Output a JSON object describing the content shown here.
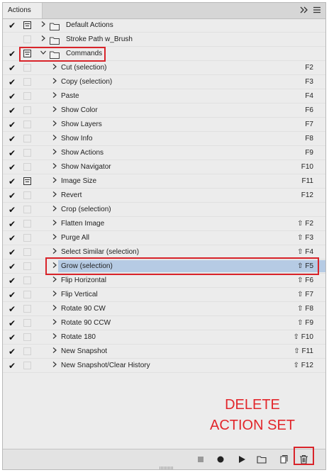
{
  "panel": {
    "tab_label": "Actions",
    "collapse_glyph": "›››",
    "menu_glyph": "≡"
  },
  "rows": [
    {
      "level": 0,
      "checked": true,
      "dialog": true,
      "expanded": false,
      "folder": true,
      "label": "Default Actions",
      "shortcut": ""
    },
    {
      "level": 0,
      "checked": false,
      "dialog": false,
      "expanded": false,
      "folder": true,
      "label": "Stroke Path w_Brush",
      "shortcut": ""
    },
    {
      "level": 0,
      "checked": true,
      "dialog": true,
      "expanded": true,
      "folder": true,
      "label": "Commands",
      "shortcut": ""
    },
    {
      "level": 1,
      "checked": true,
      "dialog": false,
      "label": "Cut (selection)",
      "shortcut": "F2"
    },
    {
      "level": 1,
      "checked": true,
      "dialog": false,
      "label": "Copy (selection)",
      "shortcut": "F3"
    },
    {
      "level": 1,
      "checked": true,
      "dialog": false,
      "label": "Paste",
      "shortcut": "F4"
    },
    {
      "level": 1,
      "checked": true,
      "dialog": false,
      "label": "Show Color",
      "shortcut": "F6"
    },
    {
      "level": 1,
      "checked": true,
      "dialog": false,
      "label": "Show Layers",
      "shortcut": "F7"
    },
    {
      "level": 1,
      "checked": true,
      "dialog": false,
      "label": "Show Info",
      "shortcut": "F8"
    },
    {
      "level": 1,
      "checked": true,
      "dialog": false,
      "label": "Show Actions",
      "shortcut": "F9"
    },
    {
      "level": 1,
      "checked": true,
      "dialog": false,
      "label": "Show Navigator",
      "shortcut": "F10"
    },
    {
      "level": 1,
      "checked": true,
      "dialog": true,
      "label": "Image Size",
      "shortcut": "F11"
    },
    {
      "level": 1,
      "checked": true,
      "dialog": false,
      "label": "Revert",
      "shortcut": "F12"
    },
    {
      "level": 1,
      "checked": true,
      "dialog": false,
      "label": "Crop (selection)",
      "shortcut": ""
    },
    {
      "level": 1,
      "checked": true,
      "dialog": false,
      "label": "Flatten Image",
      "shortcut": "⇧ F2"
    },
    {
      "level": 1,
      "checked": true,
      "dialog": false,
      "label": "Purge All",
      "shortcut": "⇧ F3"
    },
    {
      "level": 1,
      "checked": true,
      "dialog": false,
      "label": "Select Similar (selection)",
      "shortcut": "⇧ F4"
    },
    {
      "level": 1,
      "checked": true,
      "dialog": false,
      "label": "Grow (selection)",
      "shortcut": "⇧ F5",
      "selected": true
    },
    {
      "level": 1,
      "checked": true,
      "dialog": false,
      "label": "Flip Horizontal",
      "shortcut": "⇧ F6"
    },
    {
      "level": 1,
      "checked": true,
      "dialog": false,
      "label": "Flip Vertical",
      "shortcut": "⇧ F7"
    },
    {
      "level": 1,
      "checked": true,
      "dialog": false,
      "label": "Rotate 90 CW",
      "shortcut": "⇧ F8"
    },
    {
      "level": 1,
      "checked": true,
      "dialog": false,
      "label": "Rotate 90 CCW",
      "shortcut": "⇧ F9"
    },
    {
      "level": 1,
      "checked": true,
      "dialog": false,
      "label": "Rotate 180",
      "shortcut": "⇧ F10"
    },
    {
      "level": 1,
      "checked": true,
      "dialog": false,
      "label": "New Snapshot",
      "shortcut": "⇧ F11"
    },
    {
      "level": 1,
      "checked": true,
      "dialog": false,
      "label": "New Snapshot/Clear History",
      "shortcut": "⇧ F12"
    }
  ],
  "annotation": {
    "line1": "DELETE",
    "line2": "ACTION SET"
  },
  "toolbar": {
    "icons": [
      "stop-icon",
      "record-icon",
      "play-icon",
      "new-set-folder-icon",
      "new-action-icon",
      "delete-trash-icon"
    ]
  },
  "colors": {
    "accent_red": "#d9242a",
    "selection": "#b6cbe4",
    "annotation_text": "#e2262b"
  }
}
